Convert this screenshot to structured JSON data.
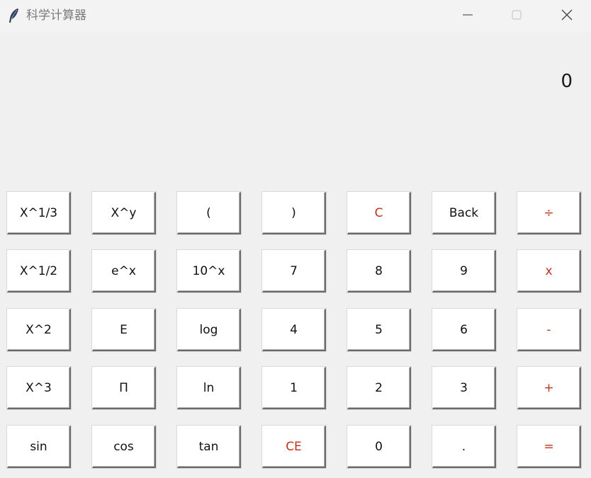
{
  "window": {
    "title": "科学计算器",
    "icon": "feather-icon",
    "controls": [
      "minimize-icon",
      "maximize-icon",
      "close-icon"
    ]
  },
  "display": {
    "value": "0"
  },
  "colors": {
    "operator": "#c4311a",
    "digit": "#111111",
    "background": "#f0f0f0"
  },
  "keys": [
    [
      "X^1/3",
      "X^y",
      "(",
      ")",
      "C",
      "Back",
      "÷"
    ],
    [
      "X^1/2",
      "e^x",
      "10^x",
      "7",
      "8",
      "9",
      "x"
    ],
    [
      "X^2",
      "E",
      "log",
      "4",
      "5",
      "6",
      "-"
    ],
    [
      "X^3",
      "Π",
      "ln",
      "1",
      "2",
      "3",
      "+"
    ],
    [
      "sin",
      "cos",
      "tan",
      "CE",
      "0",
      ".",
      "="
    ]
  ]
}
